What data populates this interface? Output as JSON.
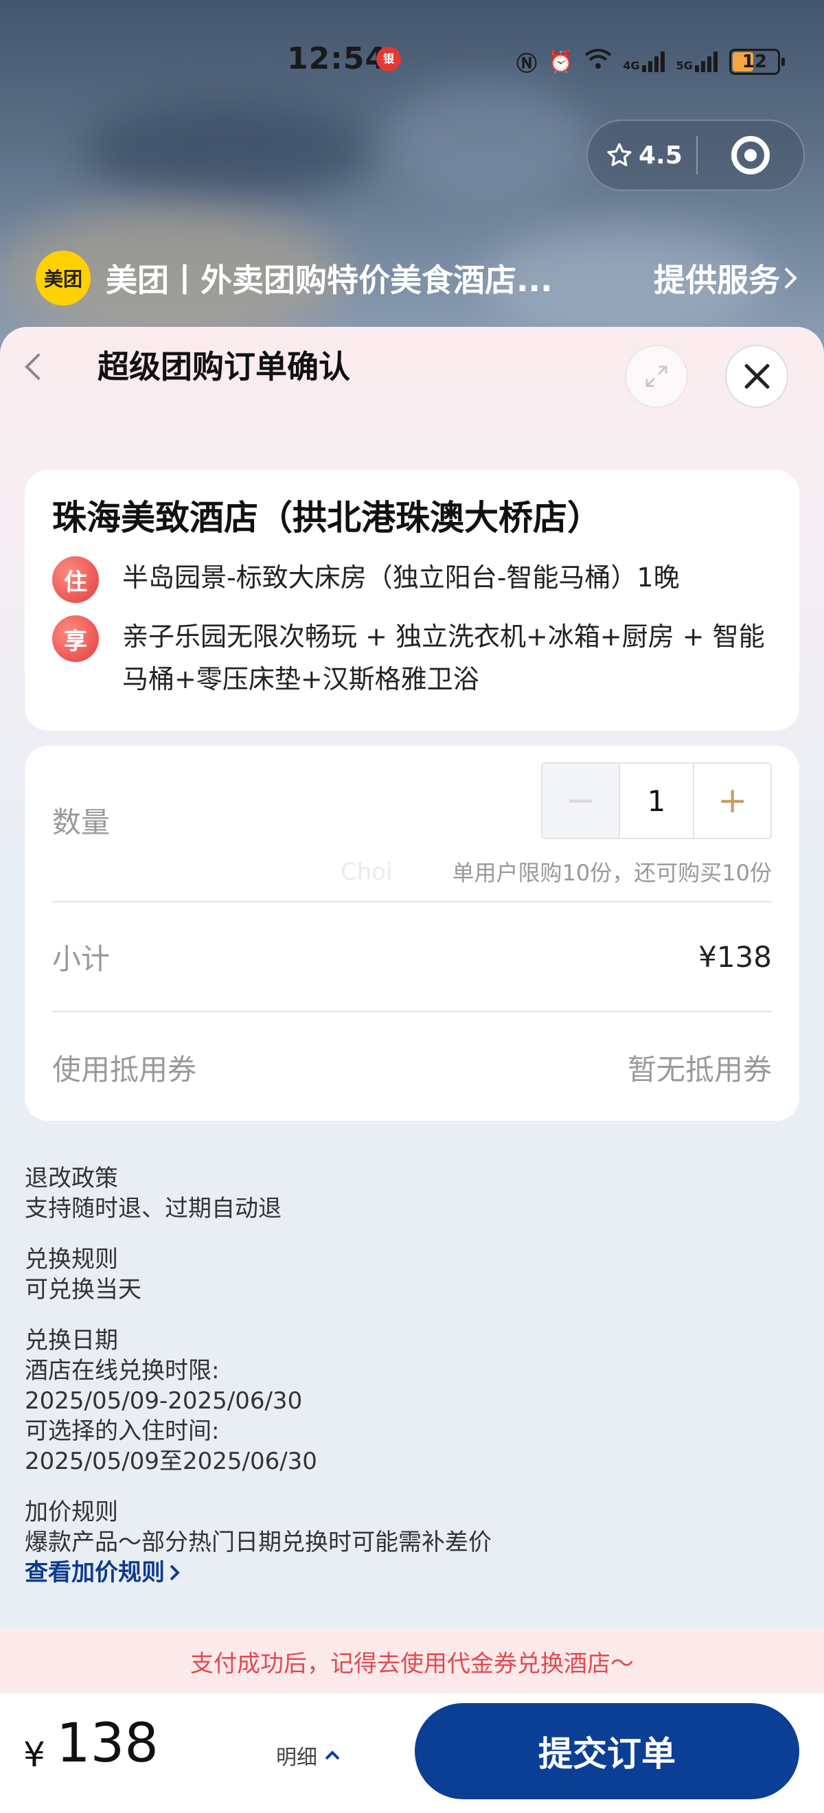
{
  "status_bar": {
    "time": "12:54",
    "time_badge": "银",
    "battery": "12",
    "signal_4g": "4G",
    "signal_5g": "5G"
  },
  "mini_program": {
    "rating": "4.5",
    "provider_logo": "美团",
    "provider_name": "美团丨外卖团购特价美食酒店...",
    "provider_link": "提供服务"
  },
  "sheet": {
    "title": "超级团购订单确认"
  },
  "hotel": {
    "name": "珠海美致酒店（拱北港珠澳大桥店）",
    "stay_tag": "住",
    "stay_text": "半岛园景-标致大床房（独立阳台-智能马桶）1晚",
    "perk_tag": "享",
    "perk_text": "亲子乐园无限次畅玩 + 独立洗衣机+冰箱+厨房 + 智能马桶+零压床垫+汉斯格雅卫浴"
  },
  "order": {
    "quantity_label": "数量",
    "quantity": "1",
    "minus": "−",
    "plus": "+",
    "quantity_hint": "单用户限购10份，还可购买10份",
    "watermark": "Choi",
    "subtotal_label": "小计",
    "subtotal_value": "¥138",
    "coupon_label": "使用抵用券",
    "coupon_value": "暂无抵用券"
  },
  "policy": {
    "refund_title": "退改政策",
    "refund_text": "支持随时退、过期自动退",
    "exchange_title": "兑换规则",
    "exchange_text": "可兑换当天",
    "date_title": "兑换日期",
    "date_line1": "酒店在线兑换时限:",
    "date_line2": "2025/05/09-2025/06/30",
    "date_line3": "可选择的入住时间:",
    "date_line4": "2025/05/09至2025/06/30",
    "surcharge_title": "加价规则",
    "surcharge_text": "爆款产品～部分热门日期兑换时可能需补差价",
    "surcharge_link": "查看加价规则"
  },
  "tip": "支付成功后，记得去使用代金券兑换酒店～",
  "bottom": {
    "currency": "¥",
    "total": "138",
    "detail": "明细",
    "submit": "提交订单"
  },
  "colors": {
    "primary": "#0b3f96",
    "tag_red": "#e23d40",
    "tip_text": "#e24a4f",
    "tip_bg": "#fce9ea",
    "provider_yellow": "#ffd100"
  }
}
